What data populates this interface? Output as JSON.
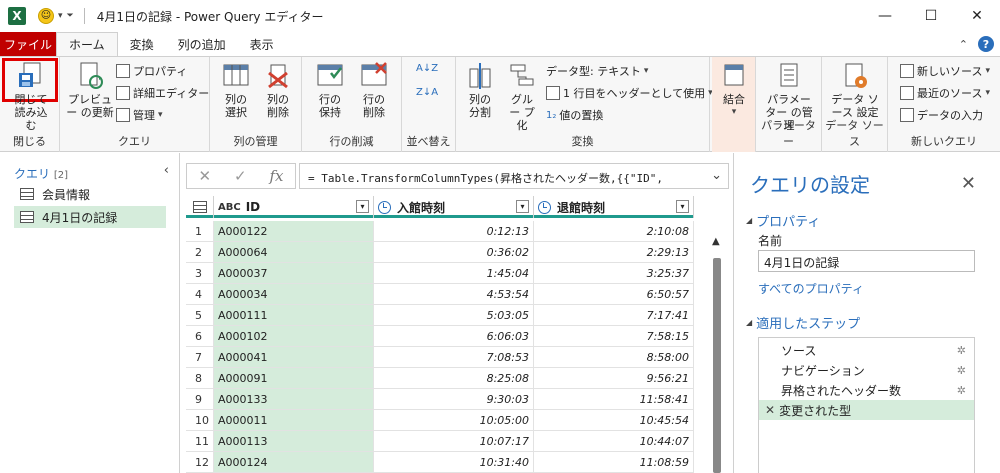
{
  "titlebar": {
    "app_icon": "X",
    "title": "4月1日の記録 - Power Query エディター",
    "minimize": "—",
    "maximize": "☐",
    "close": "✕"
  },
  "tabs": {
    "file": "ファイル",
    "items": [
      "ホーム",
      "変換",
      "列の追加",
      "表示"
    ]
  },
  "ribbon": {
    "close_group": {
      "button": "閉じて読み込む",
      "label": "閉じる"
    },
    "query_group": {
      "preview": "プレビュー の更新",
      "properties": "プロパティ",
      "advanced_editor": "詳細エディター",
      "manage": "管理",
      "label": "クエリ"
    },
    "columns_group": {
      "select": "列の 選択",
      "remove": "列の 削除",
      "label": "列の管理"
    },
    "rows_group": {
      "keep": "行の 保持",
      "remove": "行の 削除",
      "label": "行の削減"
    },
    "sort_group": {
      "label": "並べ替え"
    },
    "transform_group": {
      "split": "列の 分割",
      "group": "グルー プ化",
      "datatype": "データ型: テキスト",
      "first_row_header": "1 行目をヘッダーとして使用",
      "replace": "値の置換",
      "label": "変換"
    },
    "combine_group": {
      "combine": "結合"
    },
    "params_group": {
      "manage_params": "パラメーター の管理",
      "label": "パラメーター"
    },
    "datasource_group": {
      "settings": "データ ソース 設定",
      "label": "データ ソース"
    },
    "newquery_group": {
      "new_source": "新しいソース",
      "recent": "最近のソース",
      "enter_data": "データの入力",
      "label": "新しいクエリ"
    }
  },
  "queries_pane": {
    "header": "クエリ",
    "count": "[2]",
    "items": [
      "会員情報",
      "4月1日の記録"
    ]
  },
  "formula_bar": {
    "fx": "fx",
    "formula": "= Table.TransformColumnTypes(昇格されたヘッダー数,{{\"ID\","
  },
  "grid": {
    "columns": [
      "ID",
      "入館時刻",
      "退館時刻"
    ],
    "type_labels": [
      "ABC",
      "",
      ""
    ],
    "rows": [
      [
        "1",
        "A000122",
        "0:12:13",
        "2:10:08"
      ],
      [
        "2",
        "A000064",
        "0:36:02",
        "2:29:13"
      ],
      [
        "3",
        "A000037",
        "1:45:04",
        "3:25:37"
      ],
      [
        "4",
        "A000034",
        "4:53:54",
        "6:50:57"
      ],
      [
        "5",
        "A000111",
        "5:03:05",
        "7:17:41"
      ],
      [
        "6",
        "A000102",
        "6:06:03",
        "7:58:15"
      ],
      [
        "7",
        "A000041",
        "7:08:53",
        "8:58:00"
      ],
      [
        "8",
        "A000091",
        "8:25:08",
        "9:56:21"
      ],
      [
        "9",
        "A000133",
        "9:30:03",
        "11:58:41"
      ],
      [
        "10",
        "A000011",
        "10:05:00",
        "10:45:54"
      ],
      [
        "11",
        "A000113",
        "10:07:17",
        "10:44:07"
      ],
      [
        "12",
        "A000124",
        "10:31:40",
        "11:08:59"
      ]
    ]
  },
  "settings_pane": {
    "title": "クエリの設定",
    "properties_header": "プロパティ",
    "name_label": "名前",
    "name_value": "4月1日の記録",
    "all_properties": "すべてのプロパティ",
    "steps_header": "適用したステップ",
    "steps": [
      "ソース",
      "ナビゲーション",
      "昇格されたヘッダー数",
      "変更された型"
    ]
  }
}
